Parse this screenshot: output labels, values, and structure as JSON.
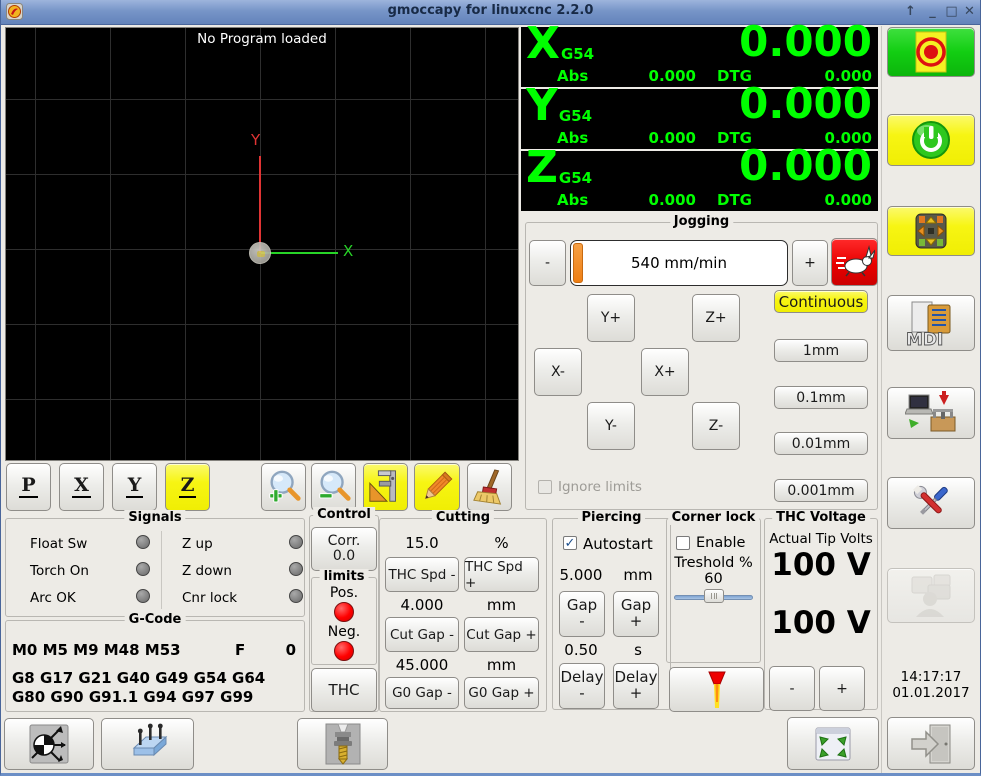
{
  "titlebar": {
    "title": "gmoccapy for linuxcnc  2.2.0",
    "controls": {
      "shade": "↑",
      "minimize": "_",
      "maximize": "□",
      "close": "✕"
    }
  },
  "preview": {
    "message": "No Program loaded",
    "x_axis": "X",
    "y_axis": "Y"
  },
  "view_toolbar": {
    "p": "P",
    "x": "X",
    "y": "Y",
    "z": "Z"
  },
  "dro": {
    "axes": [
      {
        "letter": "X",
        "system": "G54",
        "abs_label": "Abs",
        "abs_value": "0.000",
        "dtg_label": "DTG",
        "dtg_value": "0.000",
        "value": "0.000"
      },
      {
        "letter": "Y",
        "system": "G54",
        "abs_label": "Abs",
        "abs_value": "0.000",
        "dtg_label": "DTG",
        "dtg_value": "0.000",
        "value": "0.000"
      },
      {
        "letter": "Z",
        "system": "G54",
        "abs_label": "Abs",
        "abs_value": "0.000",
        "dtg_label": "DTG",
        "dtg_value": "0.000",
        "value": "0.000"
      }
    ]
  },
  "jogging": {
    "title": "Jogging",
    "minus": "-",
    "plus": "+",
    "speed": "540 mm/min",
    "continuous": "Continuous",
    "increments": [
      "1mm",
      "0.1mm",
      "0.01mm",
      "0.001mm"
    ],
    "pads": [
      "Y+",
      "Z+",
      "X-",
      "X+",
      "Y-",
      "Z-"
    ],
    "ignore_limits": "Ignore limits"
  },
  "signals": {
    "title": "Signals",
    "left": [
      "Float Sw",
      "Torch On",
      "Arc OK"
    ],
    "right": [
      "Z up",
      "Z down",
      "Cnr lock"
    ]
  },
  "gcode": {
    "title": "G-Code",
    "m_codes": "M0 M5 M9 M48 M53",
    "f_label": "F",
    "f_value": "0",
    "g_codes": "G8 G17 G21 G40 G49 G54 G64 G80 G90 G91.1 G94 G97 G99"
  },
  "control": {
    "title": "Control",
    "corr_label": "Corr.",
    "corr_value": "0.0",
    "limits": {
      "title": "limits",
      "pos": "Pos.",
      "neg": "Neg."
    },
    "thc": "THC"
  },
  "cutting": {
    "title": "Cutting",
    "rows": [
      {
        "value": "15.0",
        "unit": "%",
        "minus": "THC Spd -",
        "plus": "THC Spd +"
      },
      {
        "value": "4.000",
        "unit": "mm",
        "minus": "Cut Gap -",
        "plus": "Cut Gap +"
      },
      {
        "value": "45.000",
        "unit": "mm",
        "minus": "G0 Gap -",
        "plus": "G0 Gap +"
      }
    ]
  },
  "piercing": {
    "title": "Piercing",
    "autostart": "Autostart",
    "gap": {
      "value": "5.000",
      "unit": "mm",
      "minus_l1": "Gap",
      "minus_l2": "-",
      "plus_l1": "Gap",
      "plus_l2": "+"
    },
    "delay": {
      "value": "0.50",
      "unit": "s",
      "minus_l1": "Delay",
      "minus_l2": "-",
      "plus_l1": "Delay",
      "plus_l2": "+"
    }
  },
  "corner_lock": {
    "title": "Corner lock",
    "enable": "Enable",
    "threshold_label": "Treshold %",
    "threshold_value": "60"
  },
  "thc_voltage": {
    "title": "THC Voltage",
    "label": "Actual Tip Volts",
    "actual": "100 V",
    "target": "100 V",
    "minus": "-",
    "plus": "+"
  },
  "sidebar": {
    "mdi_label": "MDI"
  },
  "clock": {
    "time": "14:17:17",
    "date": "01.01.2017"
  },
  "colors": {
    "dro_green": "#00ff00",
    "estop_green": "#12ce12",
    "button_yellow": "#f7f513",
    "rabbit_red": "#e80000",
    "led_red": "#ff0000",
    "led_gray": "#868686",
    "titlebar_blue": "#7795c8"
  }
}
